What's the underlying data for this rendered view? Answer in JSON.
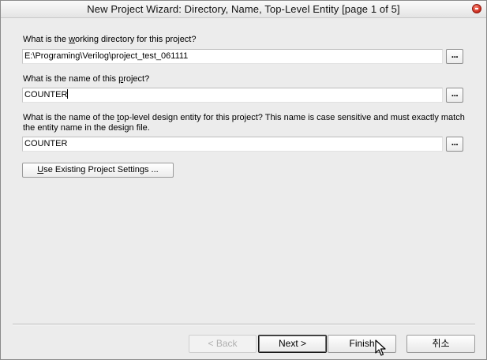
{
  "window": {
    "title": "New Project Wizard: Directory, Name, Top-Level Entity [page 1 of 5]"
  },
  "directory": {
    "label_before": "What is the ",
    "label_accel": "w",
    "label_after": "orking directory for this project?",
    "value": "E:\\Programing\\Verilog\\project_test_061111",
    "browse_label": "..."
  },
  "project_name": {
    "label_before": "What is the name of this ",
    "label_accel": "p",
    "label_after": "roject?",
    "value": "COUNTER",
    "browse_label": "..."
  },
  "top_entity": {
    "label_before": "What is the name of the ",
    "label_accel": "t",
    "label_after": "op-level design entity for this project? This name is case sensitive and must exactly match the entity name in the design file.",
    "value": "COUNTER",
    "browse_label": "..."
  },
  "existing_settings": {
    "accel": "U",
    "label_rest": "se Existing Project Settings ..."
  },
  "buttons": {
    "back": "< Back",
    "next": "Next >",
    "finish": "Finish",
    "cancel": "취소"
  },
  "colors": {
    "window_bg": "#ececec",
    "close_button": "#c8281a"
  }
}
